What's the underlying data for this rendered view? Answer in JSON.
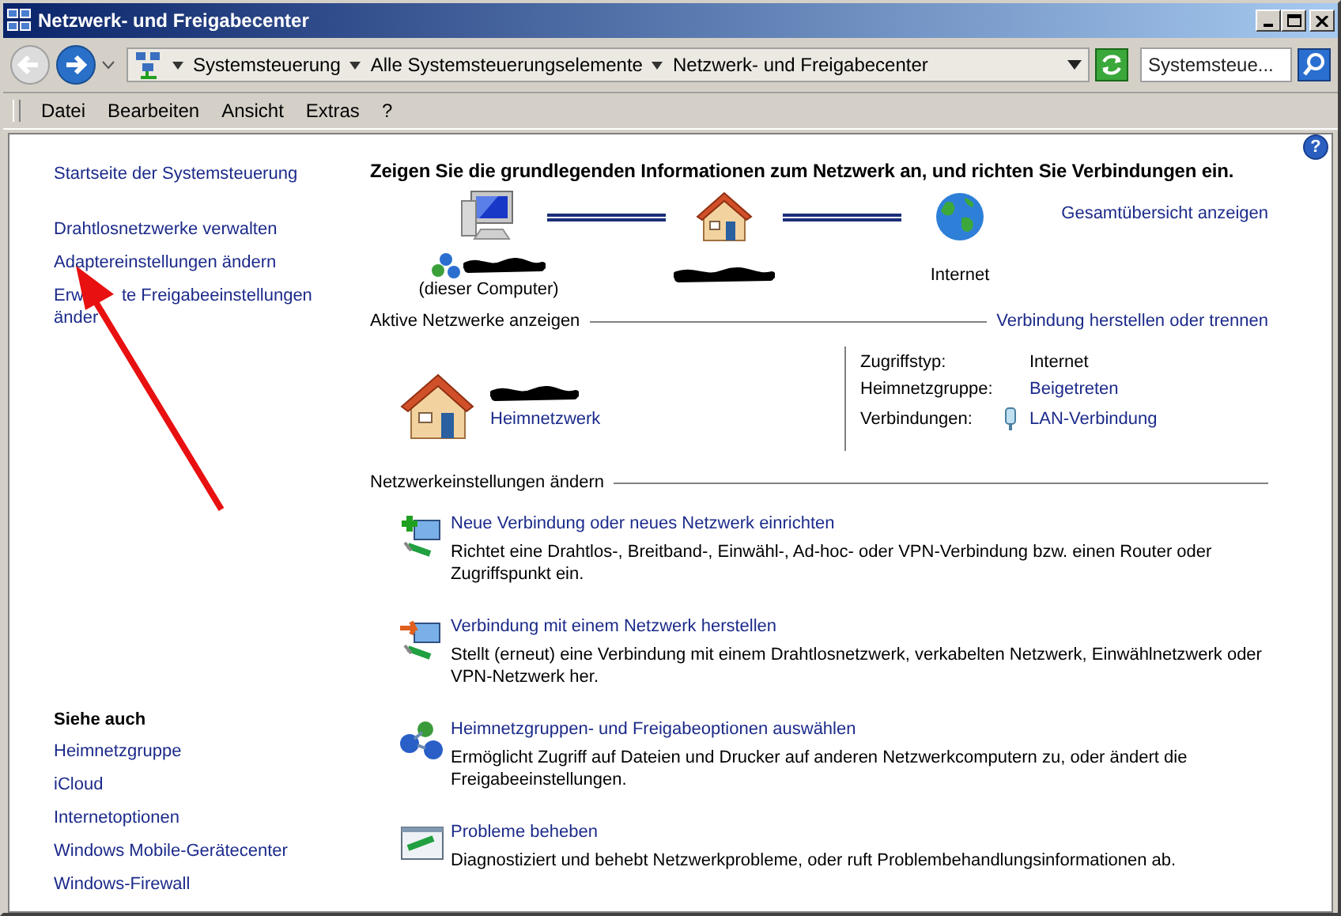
{
  "window": {
    "title": "Netzwerk- und Freigabecenter"
  },
  "address_bar": {
    "breadcrumbs": [
      "Systemsteuerung",
      "Alle Systemsteuerungselemente",
      "Netzwerk- und Freigabecenter"
    ]
  },
  "search": {
    "placeholder": "Systemsteue..."
  },
  "menu": [
    "Datei",
    "Bearbeiten",
    "Ansicht",
    "Extras",
    "?"
  ],
  "sidebar": {
    "link_groups": [
      [
        {
          "label": "Startseite der Systemsteuerung"
        }
      ],
      [
        {
          "label": "Drahtlosnetzwerke verwalten"
        },
        {
          "label": "Adaptereinstellungen ändern"
        },
        {
          "parts": [
            "Erw",
            "te Freigabeeinstellungen",
            "änder"
          ]
        }
      ]
    ],
    "see_also": {
      "title": "Siehe auch",
      "links": [
        "Heimnetzgruppe",
        "iCloud",
        "Internetoptionen",
        "Windows Mobile-Gerätecenter",
        "Windows-Firewall"
      ]
    }
  },
  "help": "?",
  "heading": "Zeigen Sie die grundlegenden Informationen zum Netzwerk an, und richten Sie Verbindungen ein.",
  "map": {
    "full_map_link": "Gesamtübersicht anzeigen",
    "nodes": [
      {
        "kind": "computer",
        "name_redacted": true,
        "label": "(dieser Computer)"
      },
      {
        "kind": "house",
        "name_redacted": true
      },
      {
        "kind": "globe",
        "label": "Internet"
      }
    ]
  },
  "active_networks": {
    "title": "Aktive Netzwerke anzeigen",
    "link": "Verbindung herstellen oder trennen",
    "network": {
      "name_redacted": true,
      "type": "Heimnetzwerk"
    },
    "details": [
      {
        "label": "Zugriffstyp:",
        "value": "Internet",
        "kind": "text"
      },
      {
        "label": "Heimnetzgruppe:",
        "value": "Beigetreten",
        "kind": "link"
      },
      {
        "label": "Verbindungen:",
        "value": "LAN-Verbindung",
        "kind": "connection"
      }
    ]
  },
  "settings": {
    "title": "Netzwerkeinstellungen ändern",
    "tasks": [
      {
        "kind": "new",
        "title": "Neue Verbindung oder neues Netzwerk einrichten",
        "description": "Richtet eine Drahtlos-, Breitband-, Einwähl-, Ad-hoc- oder VPN-Verbindung bzw. einen Router oder Zugriffspunkt ein."
      },
      {
        "kind": "connect",
        "title": "Verbindung mit einem Netzwerk herstellen",
        "description": "Stellt (erneut) eine Verbindung mit einem Drahtlosnetzwerk, verkabelten Netzwerk, Einwählnetzwerk oder VPN-Netzwerk her."
      },
      {
        "kind": "homegroup",
        "title": "Heimnetzgruppen- und Freigabeoptionen auswählen",
        "description": "Ermöglicht Zugriff auf Dateien und Drucker auf anderen Netzwerkcomputern zu, oder ändert die Freigabeeinstellungen."
      },
      {
        "kind": "troubleshoot",
        "title": "Probleme beheben",
        "description": "Diagnostiziert und behebt Netzwerkprobleme, oder ruft Problembehandlungsinformationen ab."
      }
    ]
  }
}
